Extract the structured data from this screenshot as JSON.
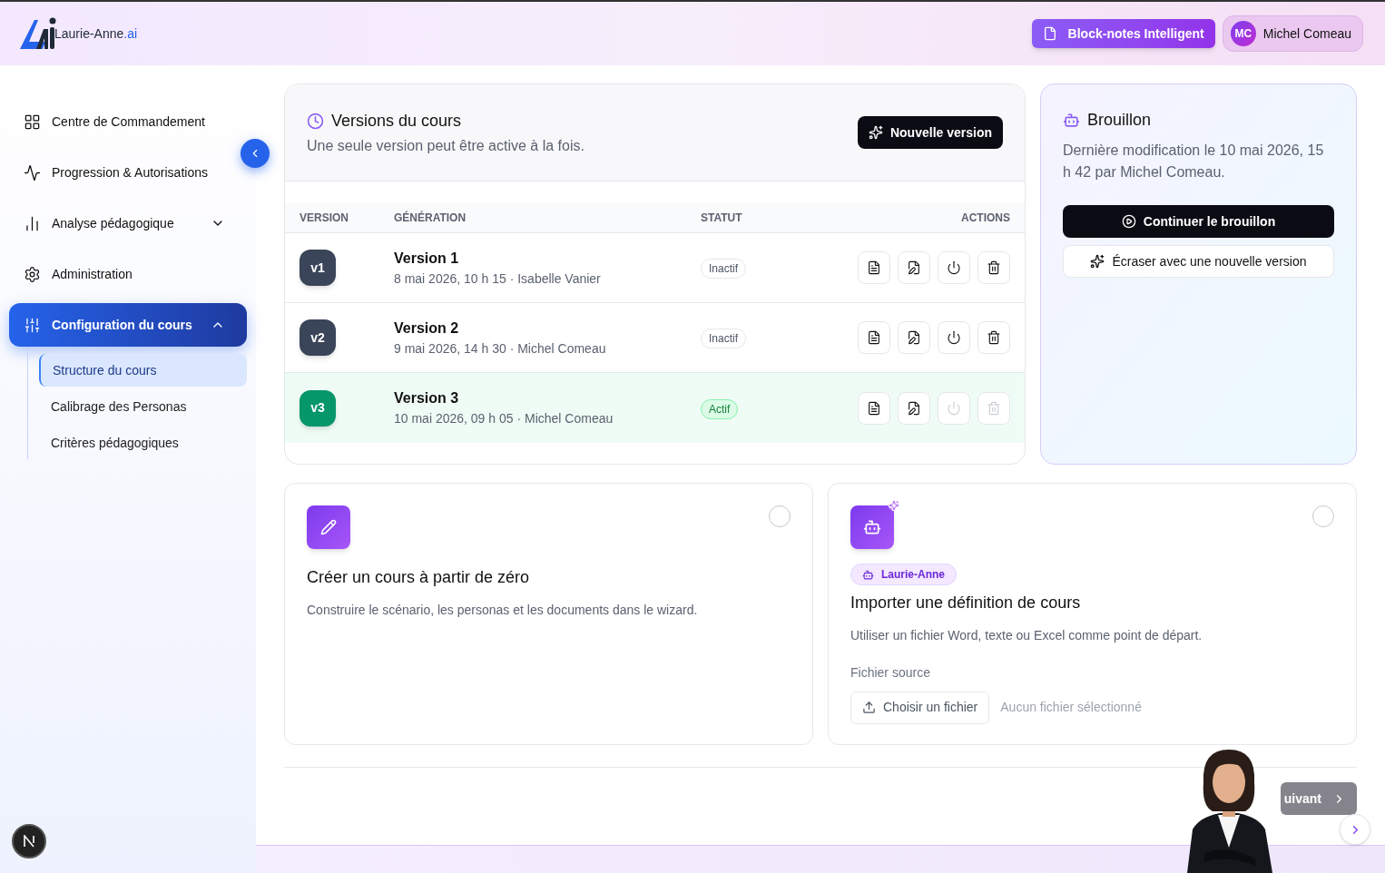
{
  "header": {
    "logo_text": "Laurie-Anne",
    "logo_suffix": ".ai",
    "notes_button": "Block-notes Intelligent",
    "user": {
      "initials": "MC",
      "name": "Michel Comeau"
    }
  },
  "sidebar": {
    "items": [
      {
        "label": "Centre de Commandement",
        "selected": false
      },
      {
        "label": "Progression & Autorisations",
        "selected": false
      },
      {
        "label": "Analyse pédagogique",
        "selected": false,
        "expanded": false
      },
      {
        "label": "Administration",
        "selected": false
      },
      {
        "label": "Configuration du cours",
        "selected": true,
        "expanded": true,
        "children": [
          {
            "label": "Structure du cours",
            "selected": true
          },
          {
            "label": "Calibrage des Personas",
            "selected": false
          },
          {
            "label": "Critères pédagogiques",
            "selected": false
          }
        ]
      }
    ]
  },
  "versions": {
    "title": "Versions du cours",
    "subtitle": "Une seule version peut être active à la fois.",
    "new_button": "Nouvelle version",
    "columns": [
      "VERSION",
      "GÉNÉRATION",
      "STATUT",
      "ACTIONS"
    ],
    "rows": [
      {
        "badge": "v1",
        "name": "Version 1",
        "meta": "8 mai 2026, 10 h 15 · Isabelle Vanier",
        "status": "Inactif",
        "active": false
      },
      {
        "badge": "v2",
        "name": "Version 2",
        "meta": "9 mai 2026, 14 h 30 · Michel Comeau",
        "status": "Inactif",
        "active": false
      },
      {
        "badge": "v3",
        "name": "Version 3",
        "meta": "10 mai 2026, 09 h 05 · Michel Comeau",
        "status": "Actif",
        "active": true
      }
    ]
  },
  "draft": {
    "title": "Brouillon",
    "text": "Dernière modification le 10 mai 2026, 15 h 42 par Michel Comeau.",
    "continue_button": "Continuer le brouillon",
    "overwrite_button": "Écraser avec une nouvelle version"
  },
  "options": [
    {
      "title": "Créer un cours à partir de zéro",
      "description": "Construire le scénario, les personas et les documents dans le wizard.",
      "selected": false
    },
    {
      "tag": "Laurie-Anne",
      "title": "Importer une définition de cours",
      "description": "Utiliser un fichier Word, texte ou Excel comme point de départ.",
      "selected": false,
      "file_label": "Fichier source",
      "file_button": "Choisir un fichier",
      "file_status": "Aucun fichier sélectionné"
    }
  ],
  "footer": {
    "next_button": "uivant"
  }
}
